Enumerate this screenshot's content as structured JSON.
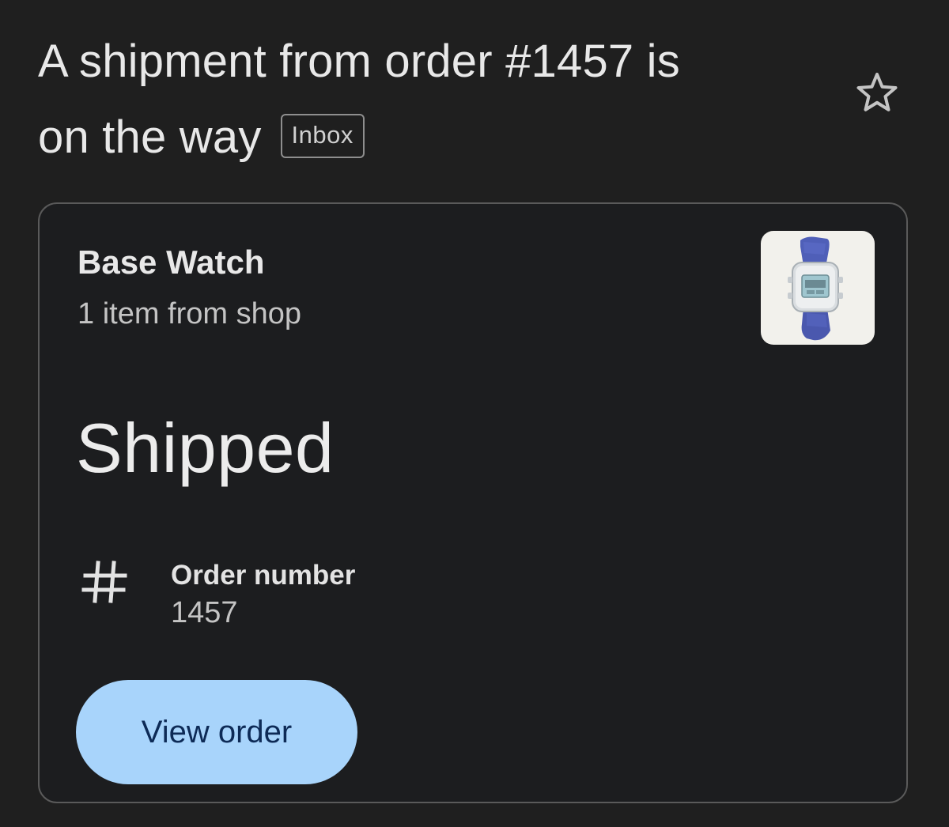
{
  "email": {
    "subject_line1": "A shipment from order #1457 is",
    "subject_line2": "on the way",
    "label": "Inbox",
    "star_icon": "star-outline-icon"
  },
  "card": {
    "shop_name": "Base Watch",
    "shop_subtitle": "1 item from shop",
    "product_image_icon": "watch-product-image",
    "status": "Shipped",
    "order": {
      "icon": "hash-icon",
      "label": "Order number",
      "value": "1457"
    },
    "button_label": "View order"
  },
  "colors": {
    "background": "#1f1f1f",
    "card_border": "#5a5a5a",
    "button_bg": "#a8d4fb",
    "button_text": "#0d2a56"
  }
}
